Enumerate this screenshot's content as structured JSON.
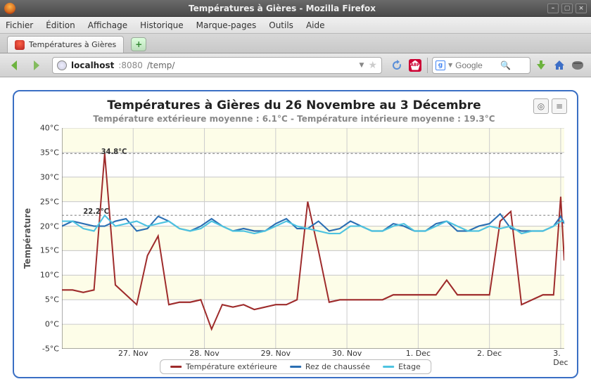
{
  "window": {
    "title": "Températures à Gières - Mozilla Firefox"
  },
  "menu": {
    "items": [
      "Fichier",
      "Édition",
      "Affichage",
      "Historique",
      "Marque-pages",
      "Outils",
      "Aide"
    ]
  },
  "tab": {
    "title": "Températures à Gières"
  },
  "url": {
    "host": "localhost",
    "port": ":8080",
    "path": "/temp/"
  },
  "search": {
    "engine": "g",
    "placeholder": "Google"
  },
  "chart": {
    "title": "Températures à Gières du 26 Novembre au 3 Décembre",
    "subtitle": "Température extérieure moyenne : 6.1°C - Température intérieure moyenne : 19.3°C",
    "ylabel": "Température",
    "yticks": [
      "-5°C",
      "0°C",
      "5°C",
      "10°C",
      "15°C",
      "20°C",
      "25°C",
      "30°C",
      "35°C",
      "40°C"
    ],
    "xticks": [
      "27. Nov",
      "28. Nov",
      "29. Nov",
      "30. Nov",
      "1. Dec",
      "2. Dec",
      "3. Dec"
    ],
    "legend": [
      {
        "label": "Température extérieure",
        "color": "#9e2b2b"
      },
      {
        "label": "Rez de chaussée",
        "color": "#2b6fb3"
      },
      {
        "label": "Etage",
        "color": "#4ec3e0"
      }
    ],
    "max_label": "34.8°C",
    "ref_label": "22.2°C"
  },
  "chart_data": {
    "type": "line",
    "xlabel": "",
    "ylabel": "Température",
    "ylim": [
      -5,
      40
    ],
    "x_unit": "days since 26 Nov (0 … 7)",
    "x": [
      0.0,
      0.15,
      0.3,
      0.45,
      0.6,
      0.75,
      0.9,
      1.05,
      1.2,
      1.35,
      1.5,
      1.65,
      1.8,
      1.95,
      2.1,
      2.25,
      2.4,
      2.55,
      2.7,
      2.85,
      3.0,
      3.15,
      3.3,
      3.45,
      3.6,
      3.75,
      3.9,
      4.05,
      4.2,
      4.35,
      4.5,
      4.65,
      4.8,
      4.95,
      5.1,
      5.25,
      5.4,
      5.55,
      5.7,
      5.85,
      6.0,
      6.15,
      6.3,
      6.45,
      6.6,
      6.75,
      6.9,
      7.0,
      7.05
    ],
    "series": [
      {
        "name": "Température extérieure",
        "color": "#9e2b2b",
        "values": [
          7,
          7,
          6.5,
          7,
          34.8,
          8,
          6,
          4,
          14,
          18,
          4,
          4.5,
          4.5,
          5,
          -1,
          4,
          3.5,
          4,
          3,
          3.5,
          4,
          4,
          5,
          25,
          15,
          4.5,
          5,
          5,
          5,
          5,
          5,
          6,
          6,
          6,
          6,
          6,
          9,
          6,
          6,
          6,
          6,
          21,
          23,
          4,
          5,
          6,
          6,
          26,
          13
        ]
      },
      {
        "name": "Rez de chaussée",
        "color": "#2b6fb3",
        "values": [
          20,
          21,
          20.5,
          20,
          20,
          21,
          21.5,
          19,
          19.5,
          22,
          21,
          19.5,
          19,
          20,
          21.5,
          20,
          19,
          19.5,
          19,
          19,
          20.5,
          21.5,
          19.5,
          19.5,
          21,
          19,
          19.5,
          21,
          20,
          19,
          19,
          20.5,
          20,
          19,
          19,
          20.5,
          21,
          19,
          19,
          20,
          20.5,
          22.5,
          19.5,
          19,
          19,
          19,
          20,
          22,
          20.5
        ]
      },
      {
        "name": "Etage",
        "color": "#4ec3e0",
        "values": [
          21,
          21,
          19.5,
          19,
          22.2,
          20,
          20.5,
          21,
          20,
          20.5,
          21,
          19.5,
          19,
          19.5,
          21,
          20,
          19,
          19,
          18.5,
          19,
          20,
          21,
          20,
          19.5,
          19,
          18.5,
          18.5,
          20,
          20,
          19,
          19,
          20,
          20.5,
          19,
          19,
          20,
          21,
          20,
          19,
          19,
          20,
          19.5,
          20,
          18.5,
          19,
          19,
          20,
          21,
          21
        ]
      }
    ],
    "reference_lines": [
      {
        "label": "22.2°C",
        "y": 22.2
      },
      {
        "label": "34.8°C",
        "y": 34.8
      }
    ],
    "averages": {
      "exterior": 6.1,
      "interior": 19.3
    }
  }
}
